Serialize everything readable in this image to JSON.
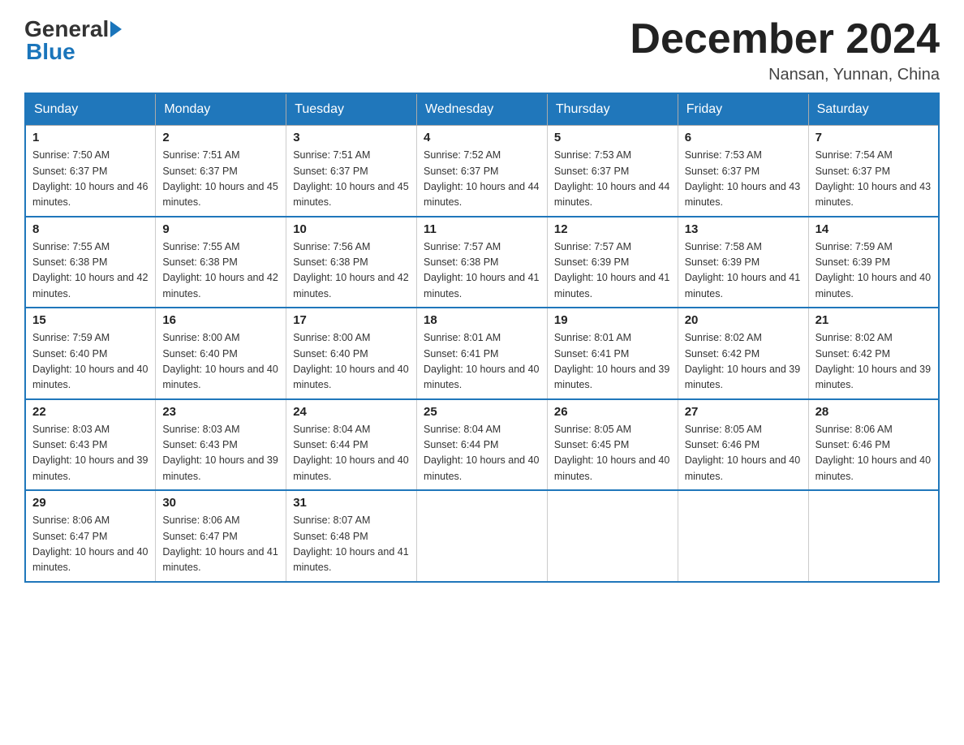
{
  "header": {
    "logo_general": "General",
    "logo_blue": "Blue",
    "month_title": "December 2024",
    "location": "Nansan, Yunnan, China"
  },
  "columns": [
    "Sunday",
    "Monday",
    "Tuesday",
    "Wednesday",
    "Thursday",
    "Friday",
    "Saturday"
  ],
  "weeks": [
    [
      {
        "day": "1",
        "sunrise": "7:50 AM",
        "sunset": "6:37 PM",
        "daylight": "10 hours and 46 minutes."
      },
      {
        "day": "2",
        "sunrise": "7:51 AM",
        "sunset": "6:37 PM",
        "daylight": "10 hours and 45 minutes."
      },
      {
        "day": "3",
        "sunrise": "7:51 AM",
        "sunset": "6:37 PM",
        "daylight": "10 hours and 45 minutes."
      },
      {
        "day": "4",
        "sunrise": "7:52 AM",
        "sunset": "6:37 PM",
        "daylight": "10 hours and 44 minutes."
      },
      {
        "day": "5",
        "sunrise": "7:53 AM",
        "sunset": "6:37 PM",
        "daylight": "10 hours and 44 minutes."
      },
      {
        "day": "6",
        "sunrise": "7:53 AM",
        "sunset": "6:37 PM",
        "daylight": "10 hours and 43 minutes."
      },
      {
        "day": "7",
        "sunrise": "7:54 AM",
        "sunset": "6:37 PM",
        "daylight": "10 hours and 43 minutes."
      }
    ],
    [
      {
        "day": "8",
        "sunrise": "7:55 AM",
        "sunset": "6:38 PM",
        "daylight": "10 hours and 42 minutes."
      },
      {
        "day": "9",
        "sunrise": "7:55 AM",
        "sunset": "6:38 PM",
        "daylight": "10 hours and 42 minutes."
      },
      {
        "day": "10",
        "sunrise": "7:56 AM",
        "sunset": "6:38 PM",
        "daylight": "10 hours and 42 minutes."
      },
      {
        "day": "11",
        "sunrise": "7:57 AM",
        "sunset": "6:38 PM",
        "daylight": "10 hours and 41 minutes."
      },
      {
        "day": "12",
        "sunrise": "7:57 AM",
        "sunset": "6:39 PM",
        "daylight": "10 hours and 41 minutes."
      },
      {
        "day": "13",
        "sunrise": "7:58 AM",
        "sunset": "6:39 PM",
        "daylight": "10 hours and 41 minutes."
      },
      {
        "day": "14",
        "sunrise": "7:59 AM",
        "sunset": "6:39 PM",
        "daylight": "10 hours and 40 minutes."
      }
    ],
    [
      {
        "day": "15",
        "sunrise": "7:59 AM",
        "sunset": "6:40 PM",
        "daylight": "10 hours and 40 minutes."
      },
      {
        "day": "16",
        "sunrise": "8:00 AM",
        "sunset": "6:40 PM",
        "daylight": "10 hours and 40 minutes."
      },
      {
        "day": "17",
        "sunrise": "8:00 AM",
        "sunset": "6:40 PM",
        "daylight": "10 hours and 40 minutes."
      },
      {
        "day": "18",
        "sunrise": "8:01 AM",
        "sunset": "6:41 PM",
        "daylight": "10 hours and 40 minutes."
      },
      {
        "day": "19",
        "sunrise": "8:01 AM",
        "sunset": "6:41 PM",
        "daylight": "10 hours and 39 minutes."
      },
      {
        "day": "20",
        "sunrise": "8:02 AM",
        "sunset": "6:42 PM",
        "daylight": "10 hours and 39 minutes."
      },
      {
        "day": "21",
        "sunrise": "8:02 AM",
        "sunset": "6:42 PM",
        "daylight": "10 hours and 39 minutes."
      }
    ],
    [
      {
        "day": "22",
        "sunrise": "8:03 AM",
        "sunset": "6:43 PM",
        "daylight": "10 hours and 39 minutes."
      },
      {
        "day": "23",
        "sunrise": "8:03 AM",
        "sunset": "6:43 PM",
        "daylight": "10 hours and 39 minutes."
      },
      {
        "day": "24",
        "sunrise": "8:04 AM",
        "sunset": "6:44 PM",
        "daylight": "10 hours and 40 minutes."
      },
      {
        "day": "25",
        "sunrise": "8:04 AM",
        "sunset": "6:44 PM",
        "daylight": "10 hours and 40 minutes."
      },
      {
        "day": "26",
        "sunrise": "8:05 AM",
        "sunset": "6:45 PM",
        "daylight": "10 hours and 40 minutes."
      },
      {
        "day": "27",
        "sunrise": "8:05 AM",
        "sunset": "6:46 PM",
        "daylight": "10 hours and 40 minutes."
      },
      {
        "day": "28",
        "sunrise": "8:06 AM",
        "sunset": "6:46 PM",
        "daylight": "10 hours and 40 minutes."
      }
    ],
    [
      {
        "day": "29",
        "sunrise": "8:06 AM",
        "sunset": "6:47 PM",
        "daylight": "10 hours and 40 minutes."
      },
      {
        "day": "30",
        "sunrise": "8:06 AM",
        "sunset": "6:47 PM",
        "daylight": "10 hours and 41 minutes."
      },
      {
        "day": "31",
        "sunrise": "8:07 AM",
        "sunset": "6:48 PM",
        "daylight": "10 hours and 41 minutes."
      },
      null,
      null,
      null,
      null
    ]
  ]
}
